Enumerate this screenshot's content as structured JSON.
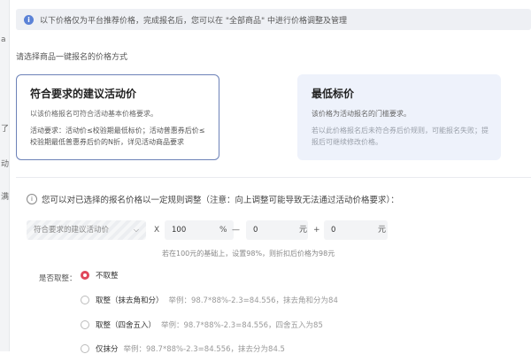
{
  "notice": {
    "text": "以下价格仅为平台推荐价格，完成报名后，您可以在 \"全部商品\" 中进行价格调整及管理"
  },
  "choose_label": "请选择商品一键报名的价格方式",
  "cards": [
    {
      "title": "符合要求的建议活动价",
      "desc": "以该价格报名可符合活动基本价格要求。",
      "requirement": "活动要求：活动价≤校验期最低标价；活动普惠券后价≤校验期最低普惠券后价的N折，详见活动商品要求",
      "selected": true
    },
    {
      "title": "最低标价",
      "desc": "该价格为活动报名的门槛要求。",
      "requirement": "若以此价格报名后未符合券后价规则，可能报名失败；提报后可继续修改价格。",
      "selected": false
    }
  ],
  "adjust_note": "您可以对已选择的报名价格以一定规则调整（注意：向上调整可能导致无法通过活动价格要求）：",
  "formula": {
    "base_select": "符合要求的建议活动价",
    "op_multiply": "X",
    "percent_value": "100",
    "percent_unit": "%",
    "op_minus": "—",
    "minus_value": "0",
    "unit_yuan_1": "元",
    "op_plus": "+",
    "plus_value": "0",
    "unit_yuan_2": "元"
  },
  "hint": "若在100元的基础上，设置98%，则折扣后价格为98元",
  "rounding": {
    "label": "是否取整：",
    "options": [
      {
        "label": "不取整",
        "example": "",
        "checked": true
      },
      {
        "label": "取整（抹去角和分）",
        "example": "举例：98.7*88%-2.3=84.556，抹去角和分为84",
        "checked": false
      },
      {
        "label": "取整（四舍五入）",
        "example": "举例：98.7*88%-2.3=84.556，四舍五入为85",
        "checked": false
      },
      {
        "label": "仅抹分",
        "example": "举例：98.7*88%-2.3=84.556，抹去分为84.5",
        "checked": false
      }
    ]
  },
  "left_strip": [
    "a",
    "了",
    "动",
    "满"
  ]
}
